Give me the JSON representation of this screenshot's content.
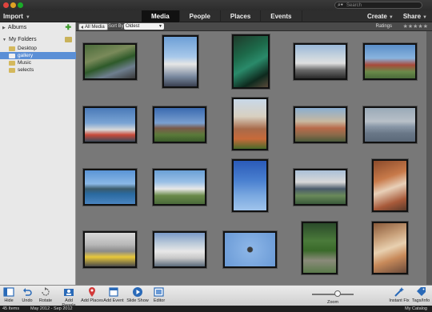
{
  "window": {
    "search_placeholder": "Search"
  },
  "topnav": {
    "import_label": "Import",
    "tabs": [
      "Media",
      "People",
      "Places",
      "Events"
    ],
    "create_label": "Create",
    "share_label": "Share"
  },
  "sidebar": {
    "albums_label": "Albums",
    "folders_label": "My Folders",
    "folders": [
      "Desktop",
      "gallery",
      "Music",
      "selects"
    ],
    "selected_folder": "gallery"
  },
  "subbar": {
    "all_media_label": "All Media",
    "sort_by_label": "Sort By:",
    "sort_value": "Oldest",
    "ratings_label": "Ratings",
    "stars": "★★★★★"
  },
  "toolbar": {
    "hide": "Hide",
    "undo": "Undo",
    "rotate": "Rotate",
    "add_people": "Add People",
    "add_places": "Add Places",
    "add_event": "Add Event",
    "slide_show": "Slide Show",
    "editor": "Editor",
    "zoom": "Zoom",
    "zoom_level": 0.62,
    "instant_fix": "Instant Fix",
    "tags_info": "Tags/Info"
  },
  "status": {
    "item_count": "45 Items",
    "date_range": "May 2012 - Sep 2012",
    "catalog": "My Catalog"
  },
  "photos": [
    {
      "name": "photo-toy-train"
    },
    {
      "name": "photo-bicycle-windmill"
    },
    {
      "name": "photo-green-chair"
    },
    {
      "name": "photo-motorcycle-house"
    },
    {
      "name": "photo-red-barn-sky"
    },
    {
      "name": "photo-ferris-wheel"
    },
    {
      "name": "photo-barn-dusk"
    },
    {
      "name": "photo-barn-flowers"
    },
    {
      "name": "photo-shed-sunset"
    },
    {
      "name": "photo-boat-on-lake"
    },
    {
      "name": "photo-lake-island"
    },
    {
      "name": "photo-small-airplane"
    },
    {
      "name": "photo-flags-pole"
    },
    {
      "name": "photo-pavilion-crowd"
    },
    {
      "name": "photo-wood-structure"
    },
    {
      "name": "photo-boat-hose"
    },
    {
      "name": "photo-white-yacht"
    },
    {
      "name": "photo-bird-sky"
    },
    {
      "name": "photo-forest-path"
    },
    {
      "name": "photo-food-dish"
    }
  ]
}
